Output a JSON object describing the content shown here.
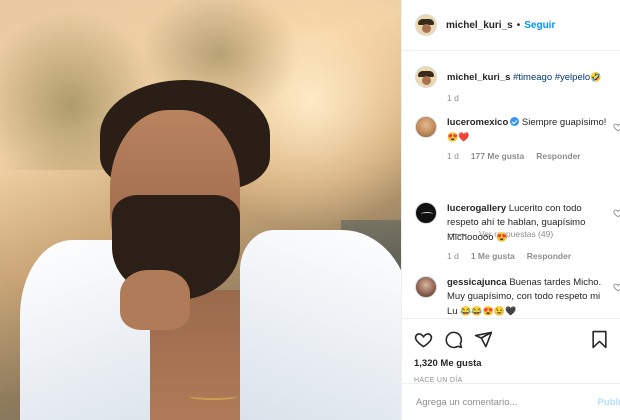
{
  "post": {
    "username": "michel_kuri_s",
    "follow_label": "Seguir",
    "caption_tags": "#timeago #yelpelo",
    "caption_emoji": "🤣",
    "caption_time": "1 d"
  },
  "comments": [
    {
      "username": "luceromexico",
      "verified": true,
      "text": "Siempre guapísimo!",
      "emoji": "😍❤️",
      "time": "1 d",
      "likes": "177 Me gusta",
      "reply": "Responder",
      "view_replies": "Ver respuestas (49)"
    },
    {
      "username": "lucerogallery",
      "text": "Lucerito con todo respeto ahí te hablan, guapísimo Michooooo",
      "emoji": "😍",
      "time": "1 d",
      "likes": "1 Me gusta",
      "reply": "Responder"
    },
    {
      "username": "gessicajunca",
      "text": "Buenas tardes Micho. Muy guapísimo, con todo respeto mi Lu",
      "emoji": "😂😂😍😉🖤"
    }
  ],
  "actions": {
    "likes_count": "1,320 Me gusta",
    "posted": "Hace un día"
  },
  "comment_box": {
    "placeholder": "Agrega un comentario...",
    "publish_label": "Publicar"
  },
  "colors": {
    "accent": "#0095f6",
    "text": "#262626",
    "muted": "#8e8e8e"
  }
}
